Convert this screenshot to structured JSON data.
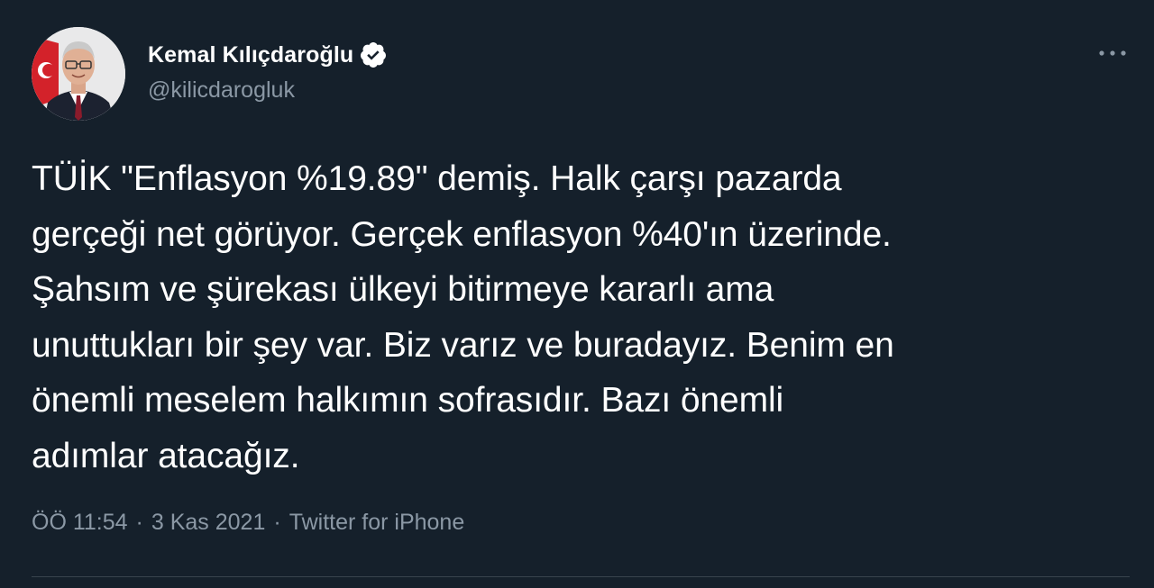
{
  "tweet": {
    "author": {
      "name": "Kemal Kılıçdaroğlu",
      "handle": "@kilicdarogluk",
      "verified": true
    },
    "text": "TÜİK \"Enflasyon %19.89\" demiş. Halk çarşı pazarda\ngerçeği net görüyor. Gerçek enflasyon %40'ın üzerinde.\nŞahsım ve şürekası ülkeyi bitirmeye kararlı ama\nunuttukları bir şey var. Biz varız ve buradayız. Benim en\nönemli meselem halkımın sofrasıdır. Bazı önemli\nadımlar atacağız.",
    "time": "ÖÖ 11:54",
    "separator": "·",
    "date": "3 Kas 2021",
    "source": "Twitter for iPhone"
  },
  "colors": {
    "background": "#15202b",
    "primary_text": "#ffffff",
    "secondary_text": "#8b98a5",
    "divider": "#38444d",
    "verified_badge": "#ffffff"
  },
  "icons": {
    "verified": "verified-badge-icon",
    "more": "more-options-icon"
  }
}
